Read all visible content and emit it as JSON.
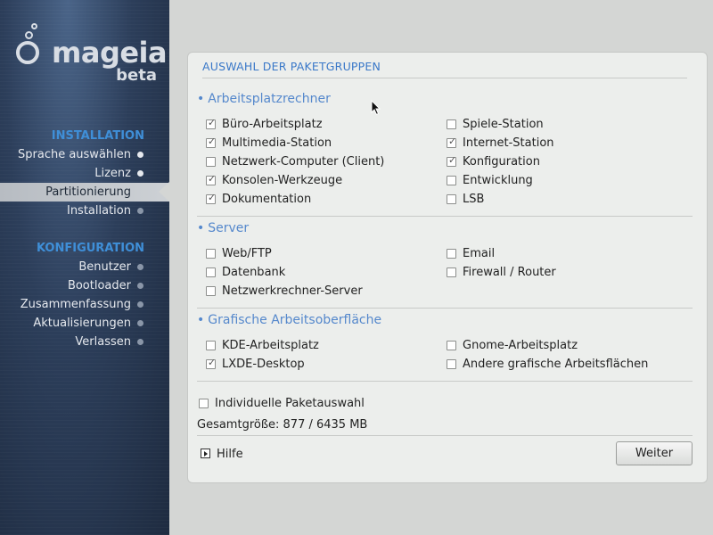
{
  "sidebar": {
    "logo": {
      "word": "mageia",
      "edition": "beta"
    },
    "sections": [
      {
        "title": "INSTALLATION",
        "items": [
          {
            "label": "Sprache auswählen",
            "state": "done"
          },
          {
            "label": "Lizenz",
            "state": "done"
          },
          {
            "label": "Partitionierung",
            "state": "active"
          },
          {
            "label": "Installation",
            "state": "pending"
          }
        ]
      },
      {
        "title": "KONFIGURATION",
        "items": [
          {
            "label": "Benutzer",
            "state": "pending"
          },
          {
            "label": "Bootloader",
            "state": "pending"
          },
          {
            "label": "Zusammenfassung",
            "state": "pending"
          },
          {
            "label": "Aktualisierungen",
            "state": "pending"
          },
          {
            "label": "Verlassen",
            "state": "pending"
          }
        ]
      }
    ]
  },
  "panel": {
    "title": "AUSWAHL DER PAKETGRUPPEN",
    "groups": [
      {
        "title": "Arbeitsplatzrechner",
        "left": [
          {
            "label": "Büro-Arbeitsplatz",
            "checked": true
          },
          {
            "label": "Multimedia-Station",
            "checked": true
          },
          {
            "label": "Netzwerk-Computer (Client)",
            "checked": false
          },
          {
            "label": "Konsolen-Werkzeuge",
            "checked": true
          },
          {
            "label": "Dokumentation",
            "checked": true
          }
        ],
        "right": [
          {
            "label": "Spiele-Station",
            "checked": false
          },
          {
            "label": "Internet-Station",
            "checked": true
          },
          {
            "label": "Konfiguration",
            "checked": true
          },
          {
            "label": "Entwicklung",
            "checked": false
          },
          {
            "label": "LSB",
            "checked": false
          }
        ]
      },
      {
        "title": "Server",
        "left": [
          {
            "label": "Web/FTP",
            "checked": false
          },
          {
            "label": "Datenbank",
            "checked": false
          },
          {
            "label": "Netzwerkrechner-Server",
            "checked": false
          }
        ],
        "right": [
          {
            "label": "Email",
            "checked": false
          },
          {
            "label": "Firewall / Router",
            "checked": false
          }
        ]
      },
      {
        "title": "Grafische Arbeitsoberfläche",
        "left": [
          {
            "label": "KDE-Arbeitsplatz",
            "checked": false
          },
          {
            "label": "LXDE-Desktop",
            "checked": true
          }
        ],
        "right": [
          {
            "label": "Gnome-Arbeitsplatz",
            "checked": false
          },
          {
            "label": "Andere grafische Arbeitsflächen",
            "checked": false
          }
        ]
      }
    ],
    "individual": {
      "label": "Individuelle Paketauswahl",
      "checked": false
    },
    "total_size": "Gesamtgröße: 877 / 6435 MB",
    "help_label": "Hilfe",
    "next_label": "Weiter"
  },
  "colors": {
    "accent": "#3a78c8",
    "section_title": "#3f8fd8",
    "sidebar_bg": "#2c3e5a"
  }
}
